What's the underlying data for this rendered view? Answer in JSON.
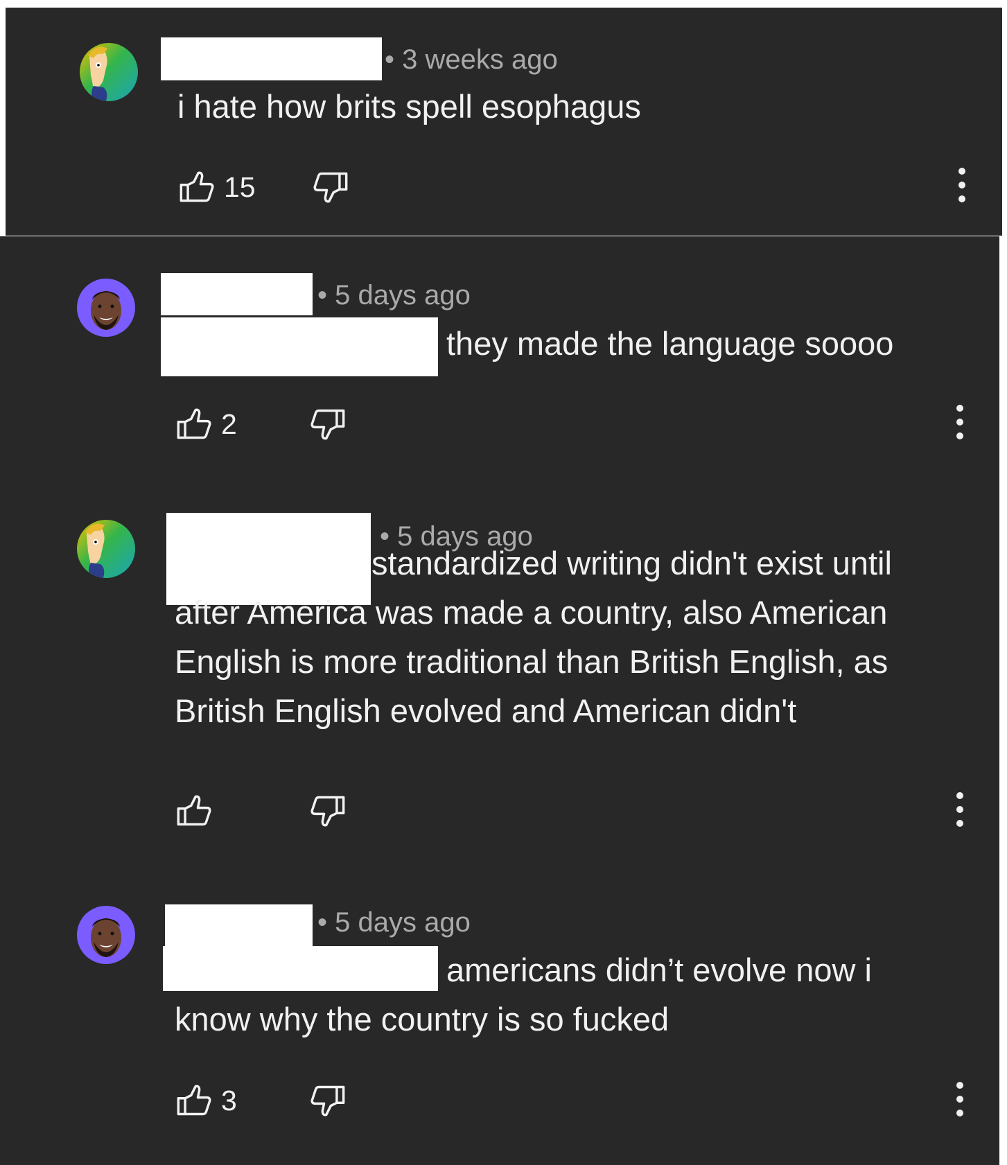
{
  "comments": [
    {
      "avatar_icon": "cartoon-character-avatar",
      "time": "• 3 weeks ago",
      "text_lines": [
        "i hate how brits spell esophagus"
      ],
      "like_count": "15"
    },
    {
      "avatar_icon": "smiling-man-avatar",
      "time": "• 5 days ago",
      "text_lines": [
        "they made the language soooo"
      ],
      "like_count": "2"
    },
    {
      "avatar_icon": "cartoon-character-avatar",
      "time": "• 5 days ago",
      "text_lines": [
        "standardized writing didn't exist until",
        "after America was made a country, also American",
        "English is more traditional than British English, as",
        "British English evolved and American didn't"
      ],
      "like_count": ""
    },
    {
      "avatar_icon": "smiling-man-avatar",
      "time": "• 5 days ago",
      "text_lines": [
        "americans didn’t evolve now i",
        "know why the country is so fucked"
      ],
      "like_count": "3"
    }
  ],
  "icons": {
    "like": "thumbs-up-icon",
    "dislike": "thumbs-down-icon",
    "more": "more-vert-icon"
  },
  "colors": {
    "background": "#282828",
    "text": "#f1f1f1",
    "meta": "#aaaaaa",
    "avatar_purple": "#7b5cff",
    "avatar_green": "#27b86a"
  }
}
